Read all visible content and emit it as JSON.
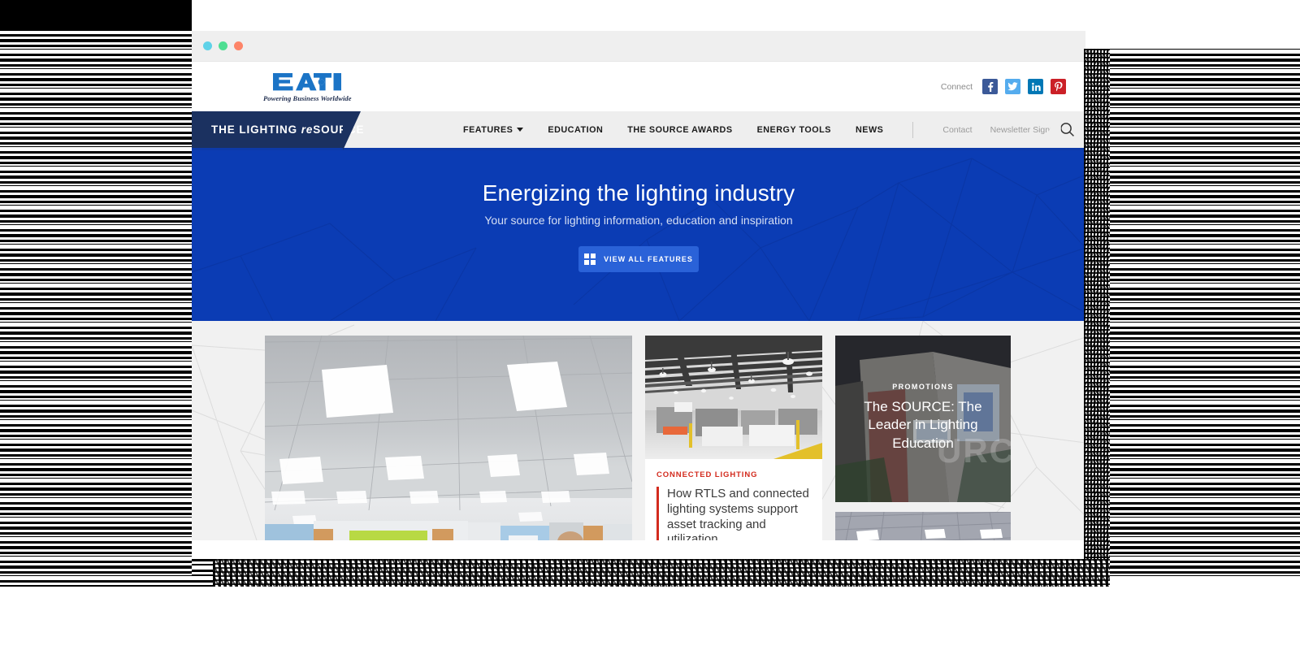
{
  "browser": {
    "traffic_lights": [
      "close-cyan",
      "minimize-green",
      "maximize-orange"
    ]
  },
  "topbar": {
    "logo_text": "EAT·N",
    "logo_tagline": "Powering Business Worldwide",
    "connect_label": "Connect",
    "social": [
      {
        "name": "facebook",
        "glyph": "f",
        "color": "#3b5998"
      },
      {
        "name": "twitter",
        "glyph": "t",
        "color": "#55acee"
      },
      {
        "name": "linkedin",
        "glyph": "in",
        "color": "#0077b5"
      },
      {
        "name": "pinterest",
        "glyph": "P",
        "color": "#cb2027"
      }
    ]
  },
  "nav": {
    "brand_prefix": "THE LIGHTING ",
    "brand_re": "re",
    "brand_suffix": "SOURCE",
    "primary": [
      {
        "label": "FEATURES",
        "has_caret": true
      },
      {
        "label": "EDUCATION",
        "has_caret": false
      },
      {
        "label": "THE SOURCE AWARDS",
        "has_caret": false
      },
      {
        "label": "ENERGY TOOLS",
        "has_caret": false
      },
      {
        "label": "NEWS",
        "has_caret": false
      }
    ],
    "secondary": [
      {
        "label": "Contact"
      },
      {
        "label": "Newsletter Signup"
      }
    ],
    "search_icon": "search-icon",
    "accent_underline": "#0d3aa9",
    "brand_tab_color": "#1b3160"
  },
  "hero": {
    "title": "Energizing the lighting industry",
    "subtitle": "Your source for lighting information, education and inspiration",
    "button_label": "VIEW ALL FEATURES",
    "button_icon": "grid-icon",
    "bg_color": "#0b3cb4",
    "button_color": "#2a62d8"
  },
  "content": {
    "cards": {
      "main_image": {
        "alt": "office-ceiling-lighting-photo"
      },
      "middle": {
        "image_alt": "industrial-warehouse-lighting-photo",
        "kicker": "CONNECTED LIGHTING",
        "title": "How RTLS and connected lighting systems support asset tracking and utilization",
        "kicker_color": "#d32b1e"
      },
      "promotion": {
        "kicker": "PROMOTIONS",
        "title": "The SOURCE: The Leader in Lighting Education",
        "watermark": "URC",
        "image_alt": "source-education-center-photo"
      },
      "promotion_secondary": {
        "image_alt": "ceiling-lights-photo"
      }
    }
  }
}
